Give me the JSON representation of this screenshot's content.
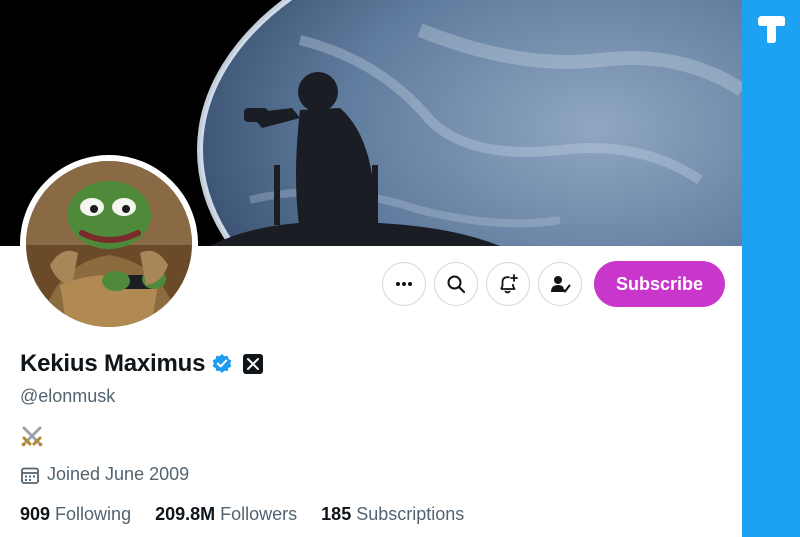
{
  "profile": {
    "display_name": "Kekius Maximus",
    "handle": "@elonmusk",
    "bio_icon": "crossed-swords-icon",
    "joined_text": "Joined June 2009",
    "verified_icon": "verified-badge-icon",
    "affiliate_icon": "x-logo-badge-icon"
  },
  "actions": {
    "more_icon": "more-dots-icon",
    "search_icon": "search-icon",
    "notify_icon": "bell-plus-icon",
    "following_icon": "person-check-icon",
    "subscribe_label": "Subscribe"
  },
  "stats": [
    {
      "value": "909",
      "label": "Following"
    },
    {
      "value": "209.8M",
      "label": "Followers"
    },
    {
      "value": "185",
      "label": "Subscriptions"
    }
  ],
  "colors": {
    "subscribe": "#c936cc",
    "verified": "#1d9bf0",
    "secondary_text": "#536471",
    "side_panel": "#1da1f2"
  }
}
